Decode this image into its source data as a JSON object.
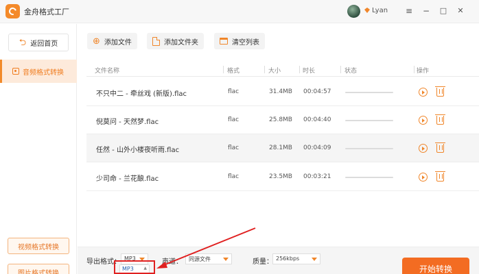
{
  "app": {
    "title": "金舟格式工厂",
    "username": "Lyan"
  },
  "window": {
    "menu_icon": "≡",
    "minimize_icon": "−",
    "maximize_icon": "□",
    "close_icon": "✕"
  },
  "sidebar": {
    "back_label": "返回首页",
    "active_item": "音频格式转换",
    "bottom_items": [
      "视频格式转换",
      "图片格式转换"
    ]
  },
  "toolbar": {
    "add_file": "添加文件",
    "add_folder": "添加文件夹",
    "clear_list": "清空列表"
  },
  "table": {
    "headers": [
      "文件名称",
      "格式",
      "大小",
      "时长",
      "状态",
      "操作"
    ],
    "rows": [
      {
        "name": "不只中二 - 牵丝戏 (新版).flac",
        "format": "flac",
        "size": "31.4MB",
        "duration": "00:04:57",
        "progress": 0
      },
      {
        "name": "倪莫问 - 天然梦.flac",
        "format": "flac",
        "size": "25.8MB",
        "duration": "00:04:40",
        "progress": 0
      },
      {
        "name": "任然 - 山外小楼夜听雨.flac",
        "format": "flac",
        "size": "28.1MB",
        "duration": "00:04:09",
        "progress": 0
      },
      {
        "name": "少司命 - 兰花酿.flac",
        "format": "flac",
        "size": "23.5MB",
        "duration": "00:03:21",
        "progress": 0
      }
    ]
  },
  "bottom": {
    "format_label": "导出格式：",
    "format_value": "MP3",
    "channel_label": "声道：",
    "channel_value": "同源文件",
    "quality_label": "质量：",
    "quality_value": "256kbps",
    "start_label": "开始转换",
    "dropdown_option": "MP3"
  },
  "colors": {
    "accent": "#f0862a",
    "start_button": "#f36c22",
    "annotation": "#e02020"
  }
}
